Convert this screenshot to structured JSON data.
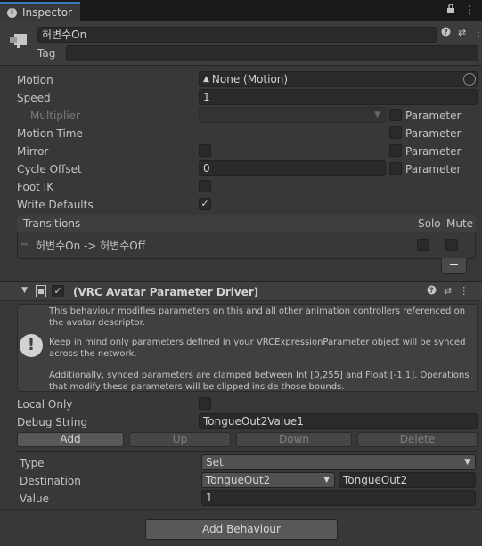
{
  "tab": {
    "label": "Inspector",
    "icons": [
      "lock-icon",
      "menu-icon"
    ]
  },
  "header": {
    "name": "허변수On",
    "tag_label": "Tag",
    "tag_value": ""
  },
  "props": {
    "motion_label": "Motion",
    "motion_value": "None (Motion)",
    "speed_label": "Speed",
    "speed_value": "1",
    "multiplier_label": "Multiplier",
    "motion_time_label": "Motion Time",
    "mirror_label": "Mirror",
    "cycle_offset_label": "Cycle Offset",
    "cycle_offset_value": "0",
    "foot_ik_label": "Foot IK",
    "write_defaults_label": "Write Defaults",
    "parameter_label": "Parameter"
  },
  "transitions": {
    "header": "Transitions",
    "solo": "Solo",
    "mute": "Mute",
    "rows": [
      "허변수On -> 허변수Off"
    ],
    "remove": "−"
  },
  "component": {
    "title": "(VRC Avatar Parameter Driver)",
    "help1": "This behaviour modifies parameters on this and all other animation controllers referenced on the avatar descriptor.",
    "help2": "Keep in mind only parameters defined in your VRCExpressionParameter object will be synced across the network.",
    "help3": "Additionally, synced parameters are clamped between Int [0,255] and Float [-1,1]. Operations that modify these parameters will be clipped inside those bounds.",
    "local_only_label": "Local Only",
    "debug_label": "Debug String",
    "debug_value": "TongueOut2Value1",
    "buttons": {
      "add": "Add",
      "up": "Up",
      "down": "Down",
      "delete": "Delete"
    },
    "type_label": "Type",
    "type_value": "Set",
    "dest_label": "Destination",
    "dest_value": "TongueOut2",
    "dest_text": "TongueOut2",
    "value_label": "Value",
    "value_value": "1"
  },
  "add_behaviour": "Add Behaviour",
  "colors": {
    "accent": "#3a79bb",
    "bg": "#383838"
  }
}
